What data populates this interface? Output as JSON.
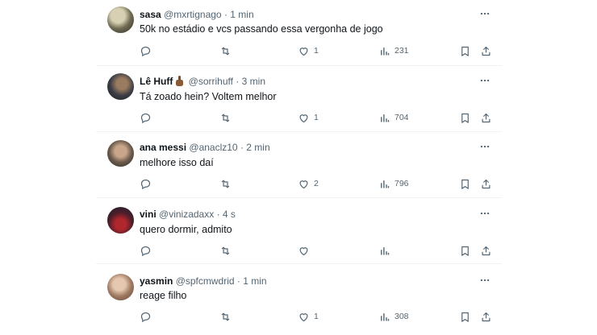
{
  "replies": [
    {
      "name": "sasa",
      "handle": "@mxrtignago",
      "time": "1 min",
      "text": "50k no estádio e vcs passando essa vergonha de jogo",
      "likes": "1",
      "views": "231",
      "avatar_colors": [
        "#c9c2a3",
        "#3b3a2e"
      ]
    },
    {
      "name": "Lê Huff",
      "handle": "@sorrihuff",
      "time": "3 min",
      "text": "Tá zoado hein? Voltem melhor",
      "likes": "1",
      "views": "704",
      "avatar_colors": [
        "#2b2e36",
        "#8a6a4f"
      ]
    },
    {
      "name": "ana messi",
      "handle": "@anaclz10",
      "time": "2 min",
      "text": "melhore isso daí",
      "likes": "2",
      "views": "796",
      "avatar_colors": [
        "#3f3b36",
        "#c9a58a"
      ]
    },
    {
      "name": "vini",
      "handle": "@vinizadaxx",
      "time": "4 s",
      "text": "quero dormir, admito",
      "likes": "",
      "views": "",
      "avatar_colors": [
        "#1d2030",
        "#b0262d"
      ]
    },
    {
      "name": "yasmin",
      "handle": "@spfcmwdrid",
      "time": "1 min",
      "text": "reage filho",
      "likes": "1",
      "views": "308",
      "avatar_colors": [
        "#d8b59c",
        "#6b4a3a"
      ]
    }
  ],
  "separator": "·",
  "icons": [
    "more-icon",
    "reply-icon",
    "retweet-icon",
    "like-icon",
    "views-icon",
    "bookmark-icon",
    "share-icon"
  ],
  "name_emoji": "middle-finger-emoji"
}
